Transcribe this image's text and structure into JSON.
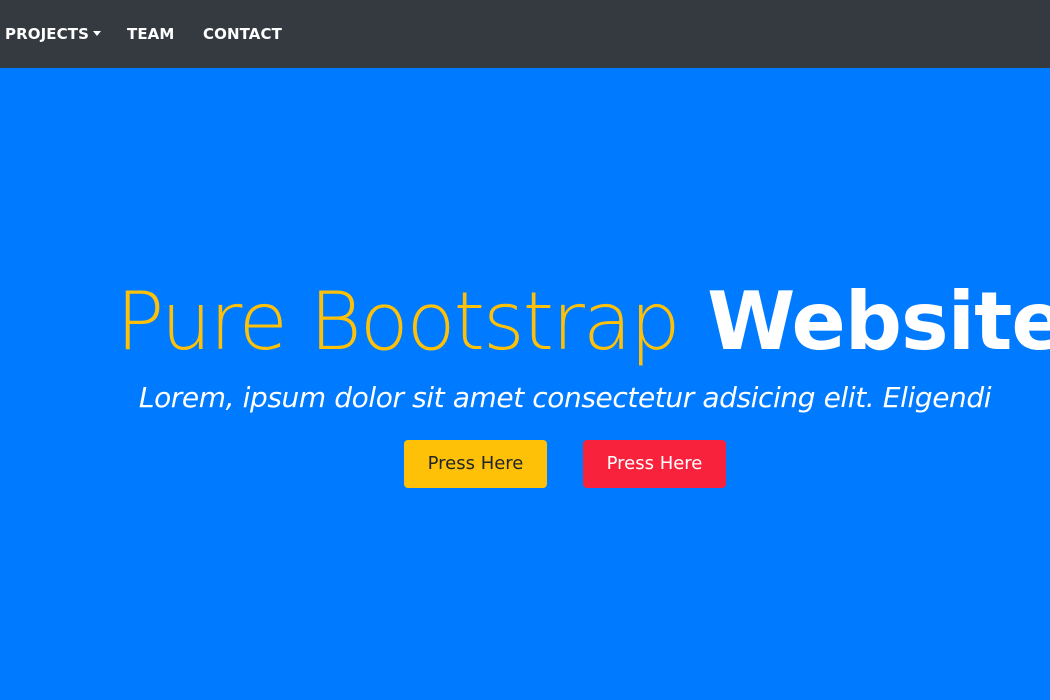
{
  "navbar": {
    "items": [
      {
        "label": "PROJECTS",
        "has_dropdown": true
      },
      {
        "label": "TEAM"
      },
      {
        "label": "CONTACT"
      }
    ],
    "background": "#343a40"
  },
  "hero": {
    "background": "#007bff",
    "title_light": "Pure Bootstrap",
    "title_bold": "Website",
    "title_light_color": "#ffc107",
    "title_bold_color": "#ffffff",
    "subtitle": "Lorem, ipsum dolor sit amet consectetur adsicing elit. Eligendi",
    "buttons": [
      {
        "label": "Press Here",
        "style": "warning",
        "color": "#ffc107"
      },
      {
        "label": "Press Here",
        "style": "danger",
        "color": "#f8223d"
      }
    ]
  }
}
